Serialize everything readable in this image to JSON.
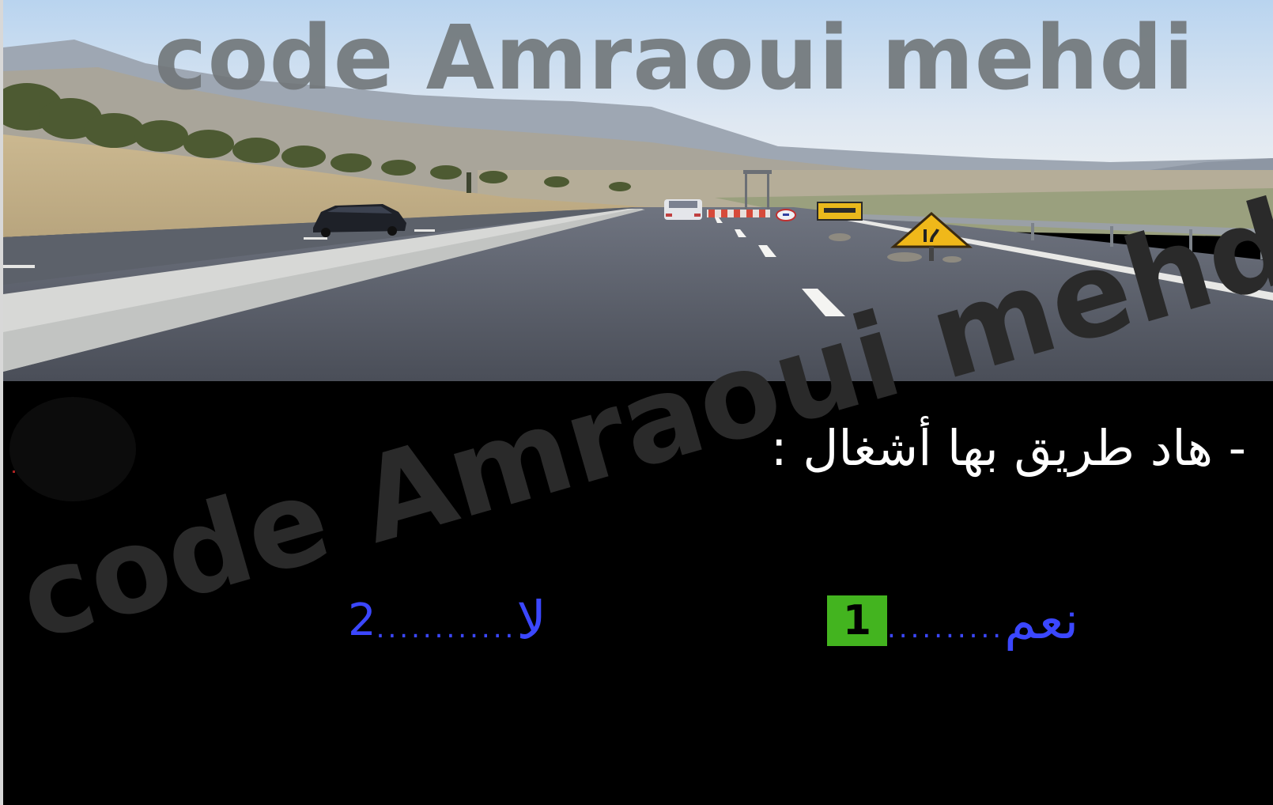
{
  "watermark": {
    "top_text": "code Amraoui mehdi",
    "diagonal_text": "code Amraoui mehdi"
  },
  "quiz": {
    "question": "- هاد طريق بها أشغال :",
    "answers": [
      {
        "number": "1",
        "label": "نعم",
        "dots": "..........",
        "selected": true
      },
      {
        "number": "2",
        "label": "لا",
        "dots": "............",
        "selected": false
      }
    ]
  },
  "colors": {
    "panel_background": "#000000",
    "question_text": "#ffffff",
    "answer_text": "#3b47ff",
    "selected_box": "#43b41f",
    "selected_number": "#000000"
  },
  "photo": {
    "description_icon": "road-works-photo"
  }
}
